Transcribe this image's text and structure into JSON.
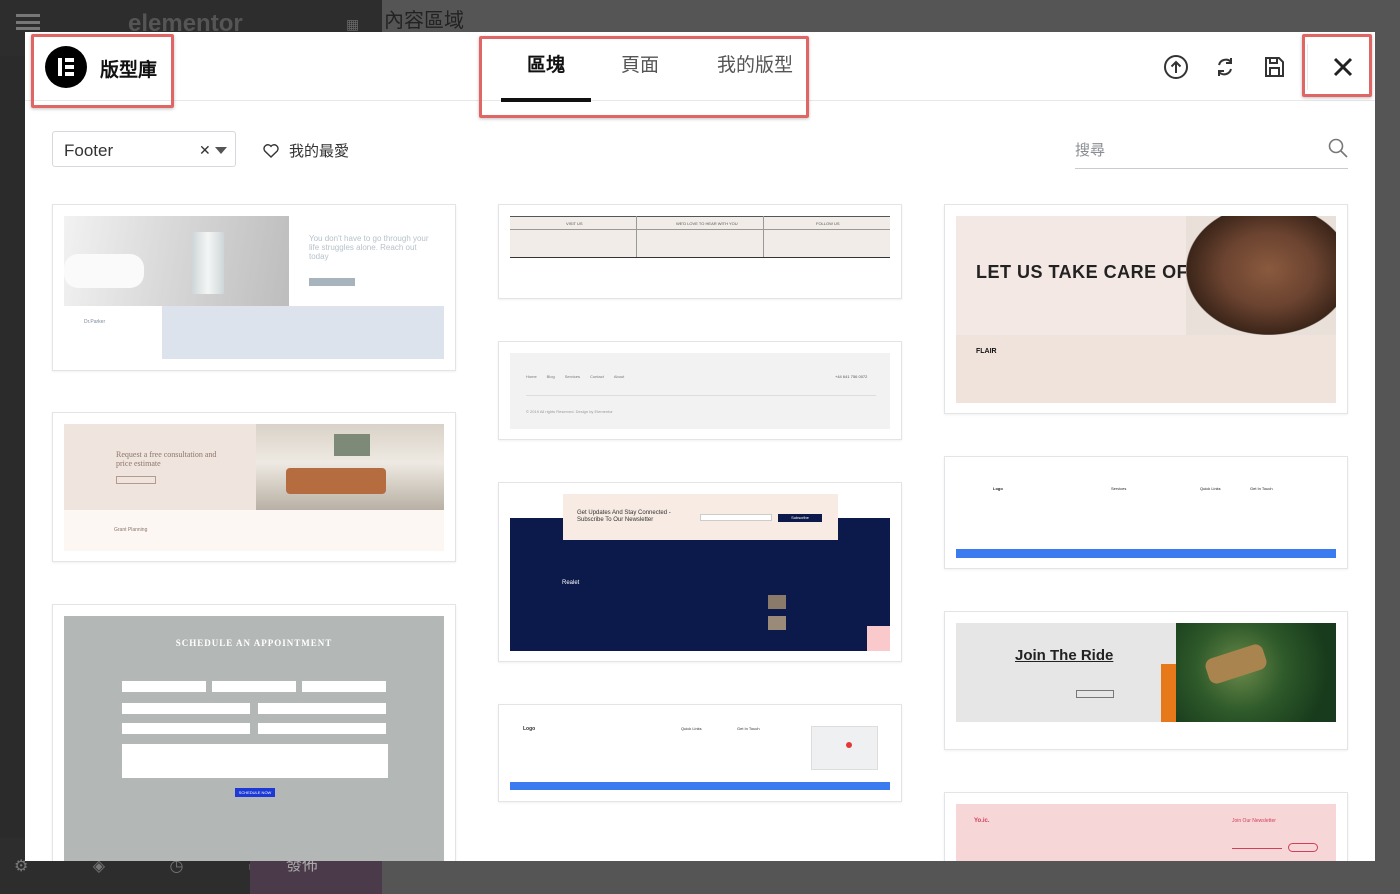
{
  "background": {
    "editor_logo": "elementor",
    "content_area_label": "內容區域",
    "publish_label": "發佈"
  },
  "library": {
    "title": "版型庫",
    "tabs": [
      {
        "label": "區塊",
        "active": true
      },
      {
        "label": "頁面",
        "active": false
      },
      {
        "label": "我的版型",
        "active": false
      }
    ],
    "header_icons": [
      "upload-icon",
      "sync-icon",
      "save-icon",
      "close-icon"
    ],
    "filter": {
      "value": "Footer"
    },
    "favorites_label": "我的最愛",
    "search_placeholder": "搜尋"
  },
  "thumbnails": {
    "card1": {
      "headline": "You don't have to go through your life struggles alone. Reach out today",
      "name": "Dr.Parker"
    },
    "card2": {
      "headline": "Request a free consultation and price estimate",
      "brand": "Grant Planning"
    },
    "card3": {
      "title": "SCHEDULE AN APPOINTMENT",
      "button": "SCHEDULE NOW"
    },
    "card4": {
      "cols": [
        "VISIT US",
        "WE'D LOVE TO HEAR WITH YOU",
        "FOLLOW US"
      ]
    },
    "card5": {
      "nav": [
        "Home",
        "Blog",
        "Services",
        "Contact",
        "About"
      ],
      "phone": "+44 641 756 0072",
      "copyright": "© 2019 All rights Reserved. Design by Elementor"
    },
    "card6": {
      "headline": "Get Updates And Stay Connected - Subscribe To Our Newsletter",
      "brand": "Realet",
      "button": "Subscribe"
    },
    "card7": {
      "logo": "Logo",
      "col2": "Quick Links",
      "col3": "Get In Touch"
    },
    "card8": {
      "headline": "LET US TAKE CARE OF YOU",
      "brand": "FLAIR"
    },
    "card9": {
      "logo": "Logo",
      "col2": "Services",
      "col3": "Quick Links",
      "col4": "Get In Touch"
    },
    "card10": {
      "headline": "Join The Ride"
    },
    "card11": {
      "logo": "Yo.ic.",
      "newsletter": "Join Our Newsletter"
    }
  },
  "colors": {
    "highlight": "#e06666",
    "navy": "#0b1a4a",
    "blue_bar": "#3a7bf0",
    "orange": "#e8791a",
    "pink_bg": "#f7d6d8",
    "blush_bg": "#f3e8e3"
  }
}
